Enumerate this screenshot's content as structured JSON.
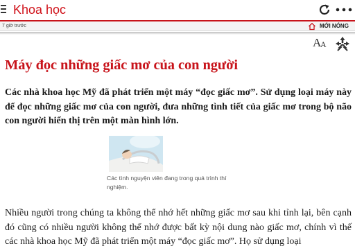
{
  "header": {
    "title": "Khoa học",
    "menu_icon": "hamburger-menu-icon",
    "refresh_icon": "refresh-icon",
    "more_icon": "more-dots-icon",
    "accent_color": "#c8141b"
  },
  "subbar": {
    "time_ago": "7 giờ trước",
    "home_icon": "home-icon",
    "latest_label": "MỚI NÓNG"
  },
  "toolbar": {
    "font_icon": "font-size-icon",
    "share_icon": "share-icon"
  },
  "article": {
    "title": "Máy đọc những giấc mơ của con người",
    "lead": "Các nhà khoa học Mỹ đã phát triển một máy “đọc giấc mơ”. Sử dụng loại máy này để đọc những giấc mơ của con người, đưa những tình tiết của giấc mơ trong bộ não con người hiển thị trên một màn hình lớn.",
    "image_caption": "Các tình nguyện viên đang trong quá trình thí nghiệm.",
    "body": "Nhiều người trong chúng ta không thể nhớ hết những giấc mơ sau khi tỉnh lại, bên cạnh đó cũng có nhiều người không thể nhớ được bất kỳ nội dung nào giấc mơ, chính vì thế các nhà khoa học Mỹ đã phát triển một máy “đọc giấc mơ”. Họ sử dụng loại"
  }
}
